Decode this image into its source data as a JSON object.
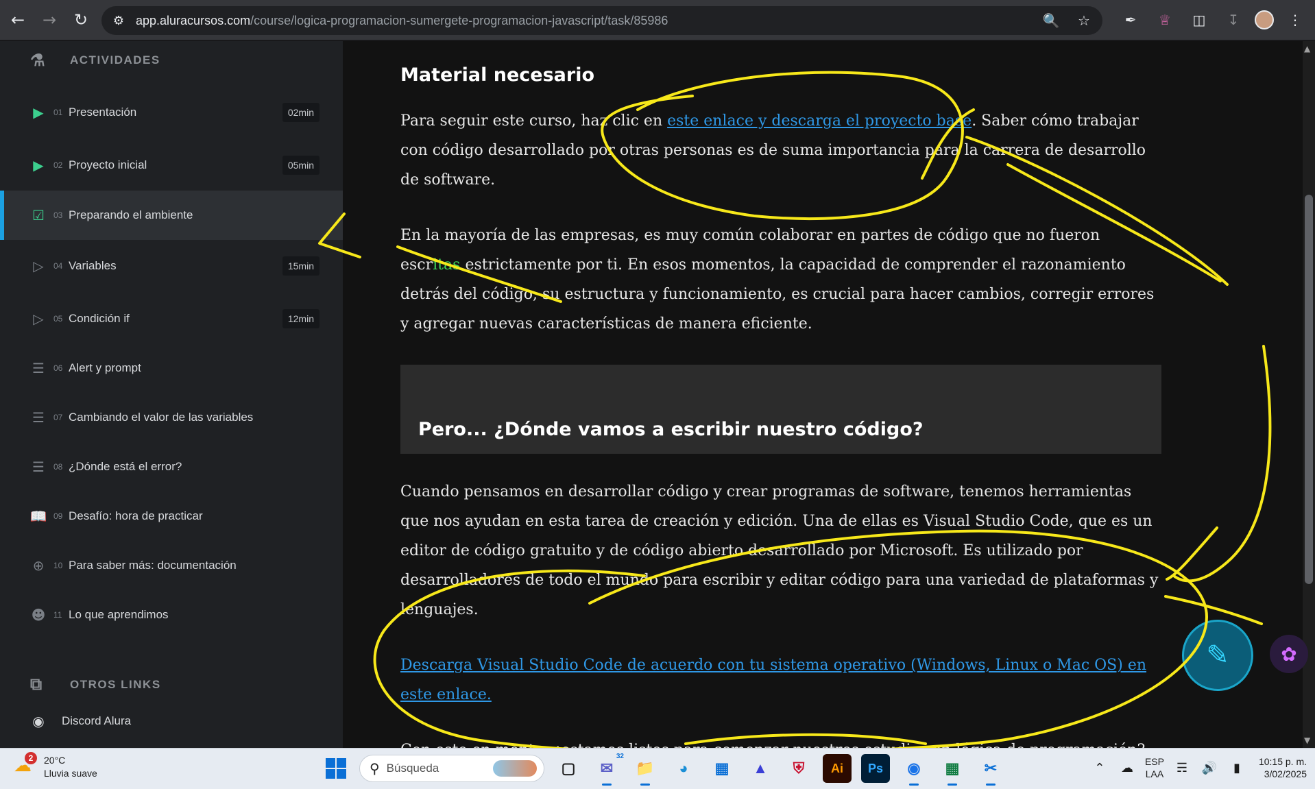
{
  "browser": {
    "url_host": "app.aluracursos.com",
    "url_path": "/course/logica-programacion-sumergete-programacion-javascript/task/85986"
  },
  "sidebar": {
    "section_title": "ACTIVIDADES",
    "items": [
      {
        "num": "01",
        "label": "Presentación",
        "duration": "02min"
      },
      {
        "num": "02",
        "label": "Proyecto inicial",
        "duration": "05min"
      },
      {
        "num": "03",
        "label": "Preparando el ambiente",
        "duration": ""
      },
      {
        "num": "04",
        "label": "Variables",
        "duration": "15min"
      },
      {
        "num": "05",
        "label": "Condición if",
        "duration": "12min"
      },
      {
        "num": "06",
        "label": "Alert y prompt",
        "duration": ""
      },
      {
        "num": "07",
        "label": "Cambiando el valor de las variables",
        "duration": ""
      },
      {
        "num": "08",
        "label": "¿Dónde está el error?",
        "duration": ""
      },
      {
        "num": "09",
        "label": "Desafío: hora de practicar",
        "duration": ""
      },
      {
        "num": "10",
        "label": "Para saber más: documentación",
        "duration": ""
      },
      {
        "num": "11",
        "label": "Lo que aprendimos",
        "duration": ""
      }
    ],
    "other_links_title": "OTROS LINKS",
    "discord_label": "Discord Alura"
  },
  "content": {
    "heading": "Material necesario",
    "p1_before": "Para seguir este curso, haz clic en ",
    "p1_link": "este enlace y descarga el proyecto base",
    "p1_after": ". Saber cómo trabajar con código desarrollado por otras personas es de suma importancia para la carrera de desarrollo de software.",
    "p2_a": "En la mayoría de las empresas, es muy común colaborar en partes de código que no fueron escr",
    "p2_hl": "itas",
    "p2_b": " estrictamente por ti. En esos momentos, la capacidad de comprender el razonamiento detrás del código, su estructura y funcionamiento, es crucial para hacer cambios, corregir errores y agregar nuevas características de manera eficiente.",
    "callout_heading": "Pero... ¿Dónde vamos a escribir nuestro código?",
    "p3": "Cuando pensamos en desarrollar código y crear programas de software, tenemos herramientas que nos ayudan en esta tarea de creación y edición. Una de ellas es Visual Studio Code, que es un editor de código gratuito y de código abierto desarrollado por Microsoft. Es utilizado por desarrolladores de todo el mundo para escribir y editar código para una variedad de plataformas y lenguajes.",
    "download_link": "Descarga Visual Studio Code de acuerdo con tu sistema operativo (Windows, Linux o Mac OS) en este enlace.",
    "p4": "Con esto en mente, ¿estamos listos para comenzar nuestros estudios en lógica de programación?"
  },
  "taskbar": {
    "weather_badge": "2",
    "temperature": "20°C",
    "weather_desc": "Lluvia suave",
    "search_placeholder": "Búsqueda",
    "lang_1": "ESP",
    "lang_2": "LAA",
    "time": "10:15 p. m.",
    "date": "3/02/2025",
    "ai_label": "Ai",
    "ps_label": "Ps",
    "chat_badge": "32"
  },
  "colors": {
    "accent_green": "#3ccf8e",
    "active_bar": "#1ba1e2",
    "link_blue": "#2f98e6",
    "annotation_yellow": "#f7e81a"
  }
}
